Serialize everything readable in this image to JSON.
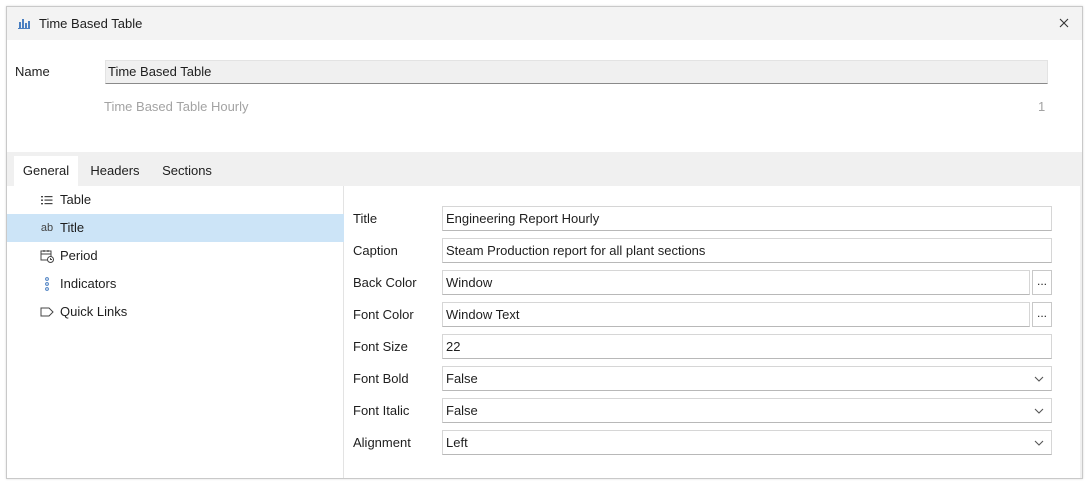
{
  "window": {
    "title": "Time Based Table",
    "icon": "bar-chart-icon"
  },
  "name_section": {
    "label": "Name",
    "value": "Time Based Table",
    "subtitle": "Time Based Table Hourly",
    "count": "1"
  },
  "tabs": [
    {
      "label": "General"
    },
    {
      "label": "Headers"
    },
    {
      "label": "Sections"
    }
  ],
  "tree": [
    {
      "label": "Table",
      "icon": "list-icon"
    },
    {
      "label": "Title",
      "icon": "text-ab-icon"
    },
    {
      "label": "Period",
      "icon": "calendar-clock-icon"
    },
    {
      "label": "Indicators",
      "icon": "vertical-dots-icon"
    },
    {
      "label": "Quick Links",
      "icon": "tag-icon"
    }
  ],
  "properties": [
    {
      "label": "Title",
      "value": "Engineering Report Hourly"
    },
    {
      "label": "Caption",
      "value": "Steam Production report for all plant sections"
    },
    {
      "label": "Back Color",
      "value": "Window",
      "button": "..."
    },
    {
      "label": "Font Color",
      "value": "Window Text",
      "button": "..."
    },
    {
      "label": "Font Size",
      "value": "22"
    },
    {
      "label": "Font Bold",
      "value": "False"
    },
    {
      "label": "Font Italic",
      "value": "False"
    },
    {
      "label": "Alignment",
      "value": "Left"
    }
  ],
  "colors": {
    "selection": "#cce4f7",
    "titlebar": "#f3f3f3",
    "tabbar": "#f0f0f0",
    "muted_text": "#a3a3a3"
  }
}
